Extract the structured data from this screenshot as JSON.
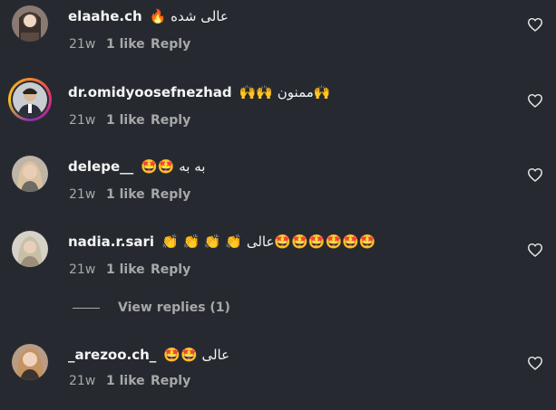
{
  "comments": [
    {
      "username": "elaahe.ch",
      "text": "🔥 عالی شده",
      "time": "21w",
      "likes": "1 like",
      "reply": "Reply"
    },
    {
      "username": "dr.omidyoosefnezhad",
      "text": "🙌🙌 ممنون🙌",
      "time": "21w",
      "likes": "1 like",
      "reply": "Reply"
    },
    {
      "username": "delepe__",
      "text": "🤩🤩 به به",
      "time": "21w",
      "likes": "1 like",
      "reply": "Reply"
    },
    {
      "username": "nadia.r.sari",
      "text": "👏 👏 👏 👏 عالی🤩🤩🤩🤩🤩🤩",
      "time": "21w",
      "likes": "1 like",
      "reply": "Reply"
    },
    {
      "username": "_arezoo.ch_",
      "text": "🤩🤩 عالی",
      "time": "21w",
      "likes": "1 like",
      "reply": "Reply"
    }
  ],
  "view_replies_label": "View replies (1)",
  "colors": {
    "background": "#262a30",
    "muted": "#a8a8a8",
    "text": "#f2f3f5"
  },
  "icons": {
    "like": "heart-outline-icon"
  }
}
